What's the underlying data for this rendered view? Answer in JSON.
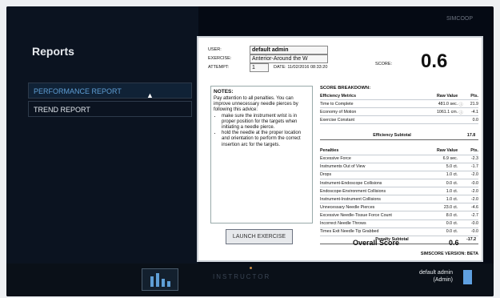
{
  "topbar": {
    "label": "SIMCOOP"
  },
  "sidebar": {
    "title": "Reports",
    "items": [
      {
        "label": "PERFORMANCE REPORT"
      },
      {
        "label": "TREND REPORT"
      }
    ]
  },
  "report": {
    "user_label": "USER:",
    "user_value": "default admin",
    "exercise_label": "EXERCISE:",
    "exercise_value": "Anterior-Around the W",
    "attempt_label": "ATTEMPT:",
    "attempt_value": "1",
    "date_text": "DATE: 11/02/2016 08:33:20",
    "score_label": "SCORE:",
    "score_value": "0.6",
    "notes": {
      "title": "NOTES:",
      "intro": "Pay attention to all penalties. You can improve unnecessary needle pierces by following this advice:",
      "bullets": [
        "make sure the instrument wrist is in proper position for the targets when initiating a needle pierce.",
        "hold the needle at the proper location and orientation to perform the correct insertion arc for the targets."
      ]
    },
    "launch_button": "LAUNCH EXERCISE",
    "breakdown": {
      "title": "SCORE BREAKDOWN:",
      "efficiency_header": [
        "Efficiency Metrics",
        "Raw Value",
        "Pts."
      ],
      "efficiency": [
        {
          "name": "Time to Complete",
          "raw": "481.0 sec.",
          "unit": "",
          "pts": "21.9"
        },
        {
          "name": "Economy of Motion",
          "raw": "1061.1 cm.",
          "unit": "",
          "pts": "-4.1"
        },
        {
          "name": "Exercise Constant",
          "raw": "",
          "unit": "",
          "pts": "0.0"
        }
      ],
      "efficiency_subtotal_label": "Efficiency Subtotal",
      "efficiency_subtotal": "17.8",
      "penalty_header": [
        "Penalties",
        "Raw Value",
        "Pts."
      ],
      "penalties": [
        {
          "name": "Excessive Force",
          "raw": "6.9 sec.",
          "pts": "-2.3"
        },
        {
          "name": "Instruments Out of View",
          "raw": "5.0 ct.",
          "pts": "-1.7"
        },
        {
          "name": "Drops",
          "raw": "1.0 ct.",
          "pts": "-2.0"
        },
        {
          "name": "Instrument-Endoscope Collisions",
          "raw": "0.0 ct.",
          "pts": "-0.0"
        },
        {
          "name": "Endoscope-Environment Collisions",
          "raw": "1.0 ct.",
          "pts": "-2.0"
        },
        {
          "name": "Instrument-Instrument Collisions",
          "raw": "1.0 ct.",
          "pts": "-2.0"
        },
        {
          "name": "Unnecessary Needle Pierces",
          "raw": "23.0 ct.",
          "pts": "-4.6"
        },
        {
          "name": "Excessive Needle-Tissue Force Count",
          "raw": "8.0 ct.",
          "pts": "-2.7"
        },
        {
          "name": "Incorrect Needle Throws",
          "raw": "0.0 ct.",
          "pts": "-0.0"
        },
        {
          "name": "Times Exit Needle Tip Grabbed",
          "raw": "0.0 ct.",
          "pts": "-0.0"
        }
      ],
      "penalty_subtotal_label": "Penalty Subtotal",
      "penalty_subtotal": "-17.2"
    },
    "overall_label": "Overall Score",
    "overall_value": "0.6",
    "version": "SIMSCORE VERSION: BETA"
  },
  "bottombar": {
    "brand": "INSTRUCTOR",
    "user_name": "default admin",
    "user_role": "(Admin)"
  },
  "icons": [
    "bar-chart-icon",
    "exit-door-icon",
    "pointer-cursor-icon"
  ]
}
